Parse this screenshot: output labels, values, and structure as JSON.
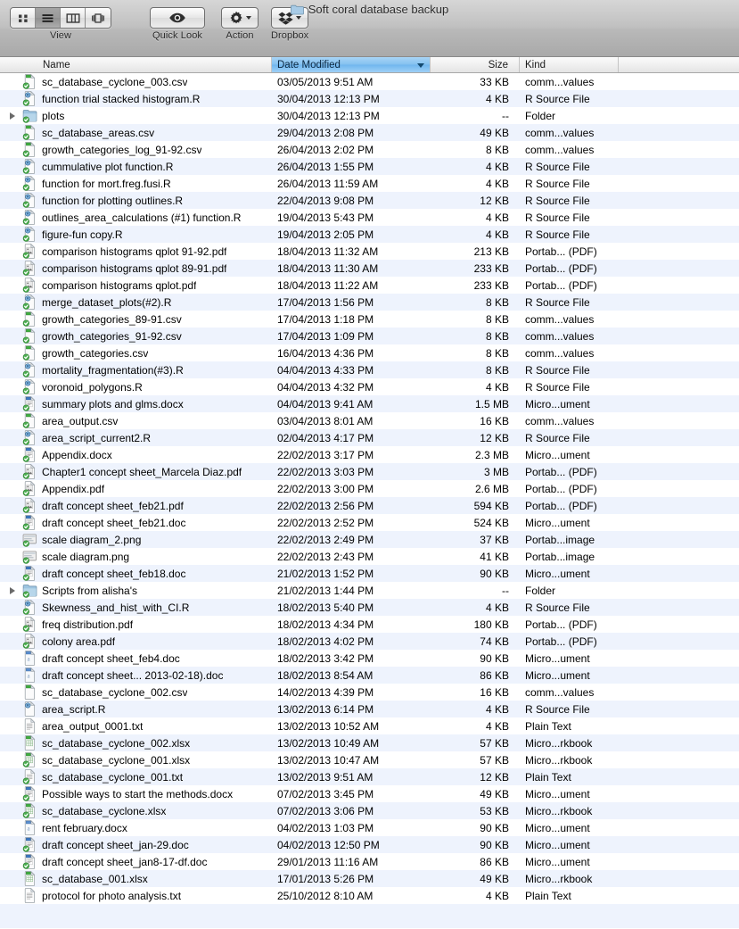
{
  "window": {
    "title": "Soft coral database backup",
    "title_icon": "folder-icon"
  },
  "toolbar": {
    "view": {
      "label": "View",
      "options": [
        {
          "name": "icon-view-button",
          "icon": "grid-icon",
          "selected": false
        },
        {
          "name": "list-view-button",
          "icon": "list-icon",
          "selected": true
        },
        {
          "name": "column-view-button",
          "icon": "columns-icon",
          "selected": false
        },
        {
          "name": "coverflow-view-button",
          "icon": "coverflow-icon",
          "selected": false
        }
      ]
    },
    "quick_look": {
      "label": "Quick Look",
      "icon": "eye-icon"
    },
    "action": {
      "label": "Action",
      "icon": "gear-icon",
      "has_menu": true
    },
    "dropbox": {
      "label": "Dropbox",
      "icon": "dropbox-icon",
      "has_menu": true
    }
  },
  "columns": [
    {
      "key": "name",
      "label": "Name",
      "sorted": false
    },
    {
      "key": "date",
      "label": "Date Modified",
      "sorted": true,
      "direction": "descending"
    },
    {
      "key": "size",
      "label": "Size",
      "sorted": false
    },
    {
      "key": "kind",
      "label": "Kind",
      "sorted": false
    }
  ],
  "colors": {
    "sort_highlight": "#84c1f0",
    "row_alt": "#eef3fd",
    "toolbar_top": "#d6d6d6",
    "toolbar_bottom": "#a9a9a9",
    "sync_badge_green": "#3da33d"
  },
  "files": [
    {
      "name": "sc_database_cyclone_003.csv",
      "date": "03/05/2013 9:51 AM",
      "size": "33 KB",
      "kind": "comm...values",
      "icon": "csv-file-icon",
      "badge": true,
      "expandable": false
    },
    {
      "name": "function trial stacked histogram.R",
      "date": "30/04/2013 12:13 PM",
      "size": "4 KB",
      "kind": "R Source File",
      "icon": "r-source-file-icon",
      "badge": true,
      "expandable": false
    },
    {
      "name": "plots",
      "date": "30/04/2013 12:13 PM",
      "size": "--",
      "kind": "Folder",
      "icon": "folder-icon",
      "badge": true,
      "expandable": true
    },
    {
      "name": "sc_database_areas.csv",
      "date": "29/04/2013 2:08 PM",
      "size": "49 KB",
      "kind": "comm...values",
      "icon": "csv-file-icon",
      "badge": true,
      "expandable": false
    },
    {
      "name": "growth_categories_log_91-92.csv",
      "date": "26/04/2013 2:02 PM",
      "size": "8 KB",
      "kind": "comm...values",
      "icon": "csv-file-icon",
      "badge": true,
      "expandable": false
    },
    {
      "name": "cummulative plot function.R",
      "date": "26/04/2013 1:55 PM",
      "size": "4 KB",
      "kind": "R Source File",
      "icon": "r-source-file-icon",
      "badge": true,
      "expandable": false
    },
    {
      "name": "function for mort.freg.fusi.R",
      "date": "26/04/2013 11:59 AM",
      "size": "4 KB",
      "kind": "R Source File",
      "icon": "r-source-file-icon",
      "badge": true,
      "expandable": false
    },
    {
      "name": "function for plotting outlines.R",
      "date": "22/04/2013 9:08 PM",
      "size": "12 KB",
      "kind": "R Source File",
      "icon": "r-source-file-icon",
      "badge": true,
      "expandable": false
    },
    {
      "name": "outlines_area_calculations (#1) function.R",
      "date": "19/04/2013 5:43 PM",
      "size": "4 KB",
      "kind": "R Source File",
      "icon": "r-source-file-icon",
      "badge": true,
      "expandable": false
    },
    {
      "name": "figure-fun copy.R",
      "date": "19/04/2013 2:05 PM",
      "size": "4 KB",
      "kind": "R Source File",
      "icon": "r-source-file-icon",
      "badge": true,
      "expandable": false
    },
    {
      "name": "comparison histograms qplot 91-92.pdf",
      "date": "18/04/2013 11:32 AM",
      "size": "213 KB",
      "kind": "Portab... (PDF)",
      "icon": "pdf-file-icon",
      "badge": true,
      "expandable": false
    },
    {
      "name": "comparison histograms qplot 89-91.pdf",
      "date": "18/04/2013 11:30 AM",
      "size": "233 KB",
      "kind": "Portab... (PDF)",
      "icon": "pdf-file-icon",
      "badge": true,
      "expandable": false
    },
    {
      "name": "comparison histograms qplot.pdf",
      "date": "18/04/2013 11:22 AM",
      "size": "233 KB",
      "kind": "Portab... (PDF)",
      "icon": "pdf-file-icon",
      "badge": true,
      "expandable": false
    },
    {
      "name": "merge_dataset_plots(#2).R",
      "date": "17/04/2013 1:56 PM",
      "size": "8 KB",
      "kind": "R Source File",
      "icon": "r-source-file-icon",
      "badge": true,
      "expandable": false
    },
    {
      "name": "growth_categories_89-91.csv",
      "date": "17/04/2013 1:18 PM",
      "size": "8 KB",
      "kind": "comm...values",
      "icon": "csv-file-icon",
      "badge": true,
      "expandable": false
    },
    {
      "name": "growth_categories_91-92.csv",
      "date": "17/04/2013 1:09 PM",
      "size": "8 KB",
      "kind": "comm...values",
      "icon": "csv-file-icon",
      "badge": true,
      "expandable": false
    },
    {
      "name": "growth_categories.csv",
      "date": "16/04/2013 4:36 PM",
      "size": "8 KB",
      "kind": "comm...values",
      "icon": "csv-file-icon",
      "badge": true,
      "expandable": false
    },
    {
      "name": "mortality_fragmentation(#3).R",
      "date": "04/04/2013 4:33 PM",
      "size": "8 KB",
      "kind": "R Source File",
      "icon": "r-source-file-icon",
      "badge": true,
      "expandable": false
    },
    {
      "name": "voronoid_polygons.R",
      "date": "04/04/2013 4:32 PM",
      "size": "4 KB",
      "kind": "R Source File",
      "icon": "r-source-file-icon",
      "badge": true,
      "expandable": false
    },
    {
      "name": "summary plots and glms.docx",
      "date": "04/04/2013 9:41 AM",
      "size": "1.5 MB",
      "kind": "Micro...ument",
      "icon": "word-doc-icon",
      "badge": true,
      "expandable": false
    },
    {
      "name": "area_output.csv",
      "date": "03/04/2013 8:01 AM",
      "size": "16 KB",
      "kind": "comm...values",
      "icon": "csv-file-icon",
      "badge": true,
      "expandable": false
    },
    {
      "name": "area_script_current2.R",
      "date": "02/04/2013 4:17 PM",
      "size": "12 KB",
      "kind": "R Source File",
      "icon": "r-source-file-icon",
      "badge": true,
      "expandable": false
    },
    {
      "name": "Appendix.docx",
      "date": "22/02/2013 3:17 PM",
      "size": "2.3 MB",
      "kind": "Micro...ument",
      "icon": "word-doc-icon",
      "badge": true,
      "expandable": false
    },
    {
      "name": " Chapter1 concept sheet_Marcela Diaz.pdf",
      "date": "22/02/2013 3:03 PM",
      "size": "3 MB",
      "kind": "Portab... (PDF)",
      "icon": "pdf-file-icon",
      "badge": true,
      "expandable": false
    },
    {
      "name": "Appendix.pdf",
      "date": "22/02/2013 3:00 PM",
      "size": "2.6 MB",
      "kind": "Portab... (PDF)",
      "icon": "pdf-file-icon",
      "badge": true,
      "expandable": false
    },
    {
      "name": "draft concept sheet_feb21.pdf",
      "date": "22/02/2013 2:56 PM",
      "size": "594 KB",
      "kind": "Portab... (PDF)",
      "icon": "pdf-file-icon",
      "badge": true,
      "expandable": false
    },
    {
      "name": "draft concept sheet_feb21.doc",
      "date": "22/02/2013 2:52 PM",
      "size": "524 KB",
      "kind": "Micro...ument",
      "icon": "word-doc-icon",
      "badge": true,
      "expandable": false
    },
    {
      "name": "scale diagram_2.png",
      "date": "22/02/2013 2:49 PM",
      "size": "37 KB",
      "kind": "Portab...image",
      "icon": "png-image-icon",
      "badge": true,
      "expandable": false
    },
    {
      "name": "scale diagram.png",
      "date": "22/02/2013 2:43 PM",
      "size": "41 KB",
      "kind": "Portab...image",
      "icon": "png-image-icon",
      "badge": true,
      "expandable": false
    },
    {
      "name": "draft concept sheet_feb18.doc",
      "date": "21/02/2013 1:52 PM",
      "size": "90 KB",
      "kind": "Micro...ument",
      "icon": "word-doc-icon",
      "badge": true,
      "expandable": false
    },
    {
      "name": "Scripts from alisha's",
      "date": "21/02/2013 1:44 PM",
      "size": "--",
      "kind": "Folder",
      "icon": "folder-icon",
      "badge": true,
      "expandable": true
    },
    {
      "name": "Skewness_and_hist_with_CI.R",
      "date": "18/02/2013 5:40 PM",
      "size": "4 KB",
      "kind": "R Source File",
      "icon": "r-source-file-icon",
      "badge": true,
      "expandable": false
    },
    {
      "name": "freq distribution.pdf",
      "date": "18/02/2013 4:34 PM",
      "size": "180 KB",
      "kind": "Portab... (PDF)",
      "icon": "pdf-file-icon",
      "badge": true,
      "expandable": false
    },
    {
      "name": "colony area.pdf",
      "date": "18/02/2013 4:02 PM",
      "size": "74 KB",
      "kind": "Portab... (PDF)",
      "icon": "pdf-file-icon",
      "badge": true,
      "expandable": false
    },
    {
      "name": "draft concept sheet_feb4.doc",
      "date": "18/02/2013 3:42 PM",
      "size": "90 KB",
      "kind": "Micro...ument",
      "icon": "word-doc-plain-icon",
      "badge": false,
      "expandable": false
    },
    {
      "name": "draft concept sheet... 2013-02-18).doc",
      "date": "18/02/2013 8:54 AM",
      "size": "86 KB",
      "kind": "Micro...ument",
      "icon": "word-doc-plain-icon",
      "badge": false,
      "expandable": false
    },
    {
      "name": "sc_database_cyclone_002.csv",
      "date": "14/02/2013 4:39 PM",
      "size": "16 KB",
      "kind": "comm...values",
      "icon": "csv-file-icon",
      "badge": false,
      "expandable": false
    },
    {
      "name": "area_script.R",
      "date": "13/02/2013 6:14 PM",
      "size": "4 KB",
      "kind": "R Source File",
      "icon": "r-source-file-icon",
      "badge": false,
      "expandable": false
    },
    {
      "name": "area_output_0001.txt",
      "date": "13/02/2013 10:52 AM",
      "size": "4 KB",
      "kind": "Plain Text",
      "icon": "plain-text-icon",
      "badge": false,
      "expandable": false
    },
    {
      "name": "sc_database_cyclone_002.xlsx",
      "date": "13/02/2013 10:49 AM",
      "size": "57 KB",
      "kind": "Micro...rkbook",
      "icon": "excel-file-icon",
      "badge": false,
      "expandable": false
    },
    {
      "name": "sc_database_cyclone_001.xlsx",
      "date": "13/02/2013 10:47 AM",
      "size": "57 KB",
      "kind": "Micro...rkbook",
      "icon": "excel-file-icon",
      "badge": true,
      "expandable": false
    },
    {
      "name": "sc_database_cyclone_001.txt",
      "date": "13/02/2013 9:51 AM",
      "size": "12 KB",
      "kind": "Plain Text",
      "icon": "plain-text-icon",
      "badge": true,
      "expandable": false
    },
    {
      "name": "Possible ways to start the methods.docx",
      "date": "07/02/2013 3:45 PM",
      "size": "49 KB",
      "kind": "Micro...ument",
      "icon": "word-doc-icon",
      "badge": true,
      "expandable": false
    },
    {
      "name": "sc_database_cyclone.xlsx",
      "date": "07/02/2013 3:06 PM",
      "size": "53 KB",
      "kind": "Micro...rkbook",
      "icon": "excel-file-icon",
      "badge": true,
      "expandable": false
    },
    {
      "name": "rent february.docx",
      "date": "04/02/2013 1:03 PM",
      "size": "90 KB",
      "kind": "Micro...ument",
      "icon": "word-doc-plain-icon",
      "badge": false,
      "expandable": false
    },
    {
      "name": "draft concept sheet_jan-29.doc",
      "date": "04/02/2013 12:50 PM",
      "size": "90 KB",
      "kind": "Micro...ument",
      "icon": "word-doc-icon",
      "badge": true,
      "expandable": false
    },
    {
      "name": "draft concept sheet_jan8-17-df.doc",
      "date": "29/01/2013 11:16 AM",
      "size": "86 KB",
      "kind": "Micro...ument",
      "icon": "word-doc-icon",
      "badge": true,
      "expandable": false
    },
    {
      "name": "sc_database_001.xlsx",
      "date": "17/01/2013 5:26 PM",
      "size": "49 KB",
      "kind": "Micro...rkbook",
      "icon": "excel-file-icon",
      "badge": false,
      "expandable": false
    },
    {
      "name": "protocol for photo analysis.txt",
      "date": "25/10/2012 8:10 AM",
      "size": "4 KB",
      "kind": "Plain Text",
      "icon": "plain-text-icon",
      "badge": false,
      "expandable": false
    }
  ]
}
